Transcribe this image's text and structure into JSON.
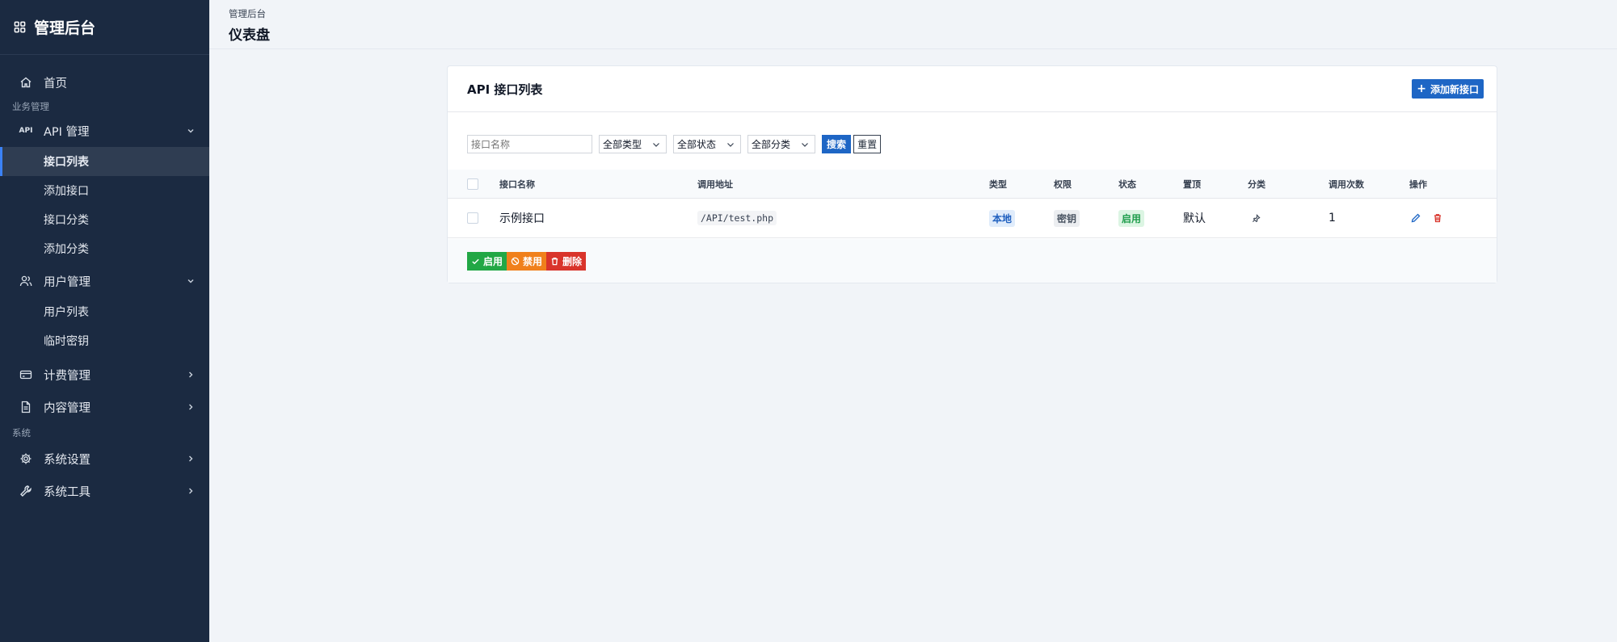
{
  "app": {
    "title": "管理后台"
  },
  "sidebar": {
    "home": "首页",
    "section_business": "业务管理",
    "api_group": {
      "label": "API 管理",
      "icon_text": "API",
      "items": [
        "接口列表",
        "添加接口",
        "接口分类",
        "添加分类"
      ],
      "active": "接口列表"
    },
    "user_group": {
      "label": "用户管理",
      "items": [
        "用户列表",
        "临时密钥"
      ]
    },
    "billing": "计费管理",
    "content": "内容管理",
    "section_system": "系统",
    "settings": "系统设置",
    "tools": "系统工具"
  },
  "header": {
    "breadcrumb": "管理后台",
    "title": "仪表盘"
  },
  "card": {
    "title": "API 接口列表",
    "add_button": "添加新接口",
    "filters": {
      "name_placeholder": "接口名称",
      "type": "全部类型",
      "status": "全部状态",
      "category": "全部分类",
      "search": "搜索",
      "reset": "重置"
    },
    "columns": [
      "接口名称",
      "调用地址",
      "类型",
      "权限",
      "状态",
      "置顶",
      "分类",
      "调用次数",
      "操作"
    ],
    "rows": [
      {
        "name": "示例接口",
        "url": "/API/test.php",
        "type": "本地",
        "auth": "密钥",
        "status": "启用",
        "pin": "默认",
        "calls": "1"
      }
    ],
    "bulk": {
      "enable": "启用",
      "disable": "禁用",
      "delete": "删除"
    }
  },
  "colors": {
    "sidebar_bg": "#1b2a41",
    "primary": "#1e66c5",
    "success": "#22a745",
    "warning": "#f0801c",
    "danger": "#d9342b"
  }
}
